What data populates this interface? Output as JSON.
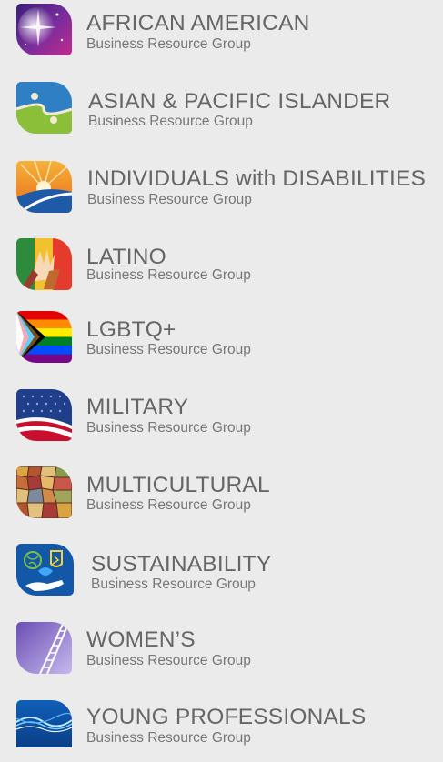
{
  "groups": [
    {
      "title": "AFRICAN AMERICAN",
      "subtitle": "Business Resource Group",
      "icon": "sparkle-burst-icon",
      "colors": [
        "#3b1f7a",
        "#c42a8c"
      ]
    },
    {
      "title": "ASIAN & PACIFIC ISLANDER",
      "subtitle": "Business Resource Group",
      "icon": "yin-yang-icon",
      "colors": [
        "#2f7fc4",
        "#8bbf3a"
      ]
    },
    {
      "title": "INDIVIDUALS with DISABILITIES",
      "subtitle": "Business Resource Group",
      "icon": "sunrise-road-icon",
      "colors": [
        "#f28c1c",
        "#1f5aa8"
      ]
    },
    {
      "title": "LATINO",
      "subtitle": "Business Resource Group",
      "icon": "hands-icon",
      "colors": [
        "#e43b2c",
        "#f2c12e"
      ]
    },
    {
      "title": "LGBTQ+",
      "subtitle": "Business Resource Group",
      "icon": "progress-pride-flag-icon",
      "colors": [
        "#e40303",
        "#732982"
      ]
    },
    {
      "title": "MILITARY",
      "subtitle": "Business Resource Group",
      "icon": "stars-and-stripes-icon",
      "colors": [
        "#1f3f8a",
        "#c8102e"
      ]
    },
    {
      "title": "MULTICULTURAL",
      "subtitle": "Business Resource Group",
      "icon": "mosaic-icon",
      "colors": [
        "#b5552f",
        "#d9a441"
      ]
    },
    {
      "title": "SUSTAINABILITY",
      "subtitle": "Business Resource Group",
      "icon": "globe-hand-icon",
      "colors": [
        "#1257a8",
        "#7ac143"
      ]
    },
    {
      "title": "WOMEN’S",
      "subtitle": "Business Resource Group",
      "icon": "ladder-icon",
      "colors": [
        "#6a4fb3",
        "#b7a6e6"
      ]
    },
    {
      "title": "YOUNG PROFESSIONALS",
      "subtitle": "Business Resource Group",
      "icon": "light-waves-icon",
      "colors": [
        "#0f5fb8",
        "#7fd0ff"
      ]
    }
  ]
}
